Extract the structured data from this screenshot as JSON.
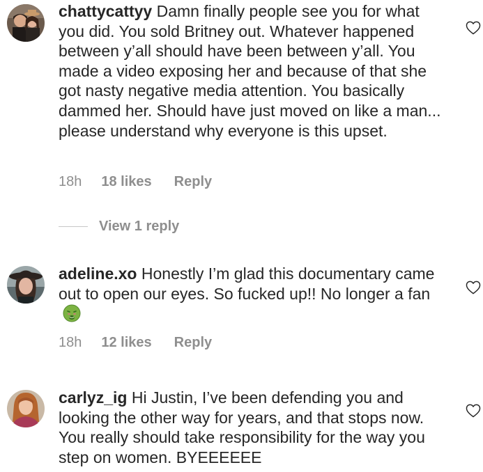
{
  "comments": [
    {
      "username": "chattycattyy",
      "text": "Damn finally people see you for what you did. You sold Britney out. Whatever happened between y’all should have been between y’all. You made a video exposing her and because of that she got nasty negative media attention. You basically dammed her. Should have just moved on like a man... please understand why everyone is this upset.",
      "time": "18h",
      "likes": "18 likes",
      "reply_label": "Reply",
      "view_replies": "View 1 reply",
      "avatar_icon": "profile-photo-couple",
      "like_icon": "heart-outline-icon"
    },
    {
      "username": "adeline.xo",
      "text": "Honestly I’m glad this documentary came out to open our eyes. So fucked up!! No longer a fan",
      "emoji": "nauseated-face-emoji",
      "time": "18h",
      "likes": "12 likes",
      "reply_label": "Reply",
      "avatar_icon": "profile-photo-hat",
      "like_icon": "heart-outline-icon"
    },
    {
      "username": "carlyz_ig",
      "text": "Hi Justin, I’ve been defending you and looking the other way for years, and that stops now. You really should take responsibility for the way you step on women. BYEEEEEE",
      "avatar_icon": "profile-photo-woman",
      "like_icon": "heart-outline-icon"
    }
  ],
  "colors": {
    "text": "#262626",
    "secondary": "#8e8e8e",
    "divider": "#c7c7c7",
    "background": "#ffffff"
  }
}
